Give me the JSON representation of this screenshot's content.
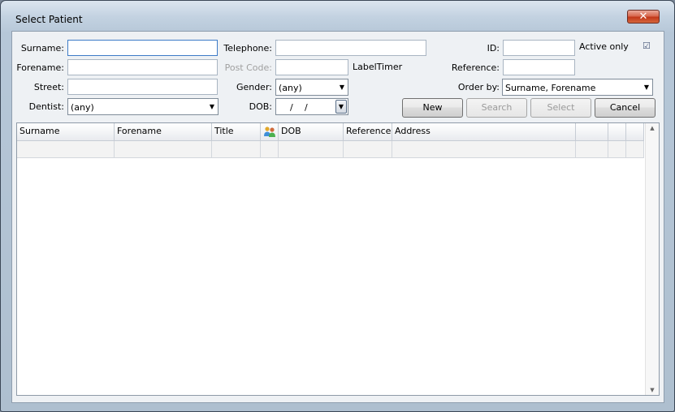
{
  "window": {
    "title": "Select Patient"
  },
  "form": {
    "surname_label": "Surname:",
    "forename_label": "Forename:",
    "street_label": "Street:",
    "dentist_label": "Dentist:",
    "dentist_value": "(any)",
    "telephone_label": "Telephone:",
    "postcode_label": "Post Code:",
    "label_timer": "LabelTimer",
    "gender_label": "Gender:",
    "gender_value": "(any)",
    "dob_label": "DOB:",
    "dob_sep": "/",
    "id_label": "ID:",
    "active_only_label": "Active only",
    "active_only_checked": true,
    "reference_label": "Reference:",
    "order_by_label": "Order by:",
    "order_by_value": "Surname, Forename"
  },
  "buttons": {
    "new": "New",
    "search": "Search",
    "select": "Select",
    "cancel": "Cancel"
  },
  "grid": {
    "columns": [
      "Surname",
      "Forename",
      "Title",
      "",
      "DOB",
      "Reference",
      "Address",
      "",
      "",
      ""
    ],
    "rows": [],
    "empty_row_count": 1
  },
  "icons": {
    "close": "close-icon",
    "people": "people-icon",
    "dropdown": "chevron-down-icon",
    "check": "checkmark-icon"
  }
}
